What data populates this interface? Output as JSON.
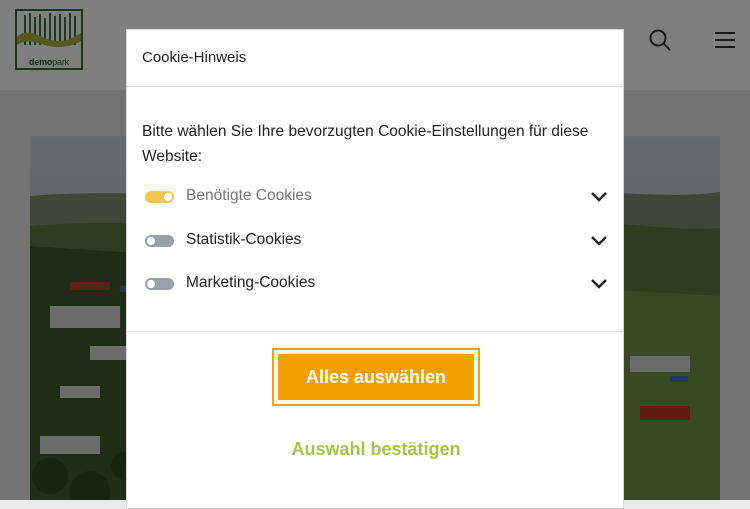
{
  "site": {
    "logo_text_bold": "demo",
    "logo_text_light": "park"
  },
  "modal": {
    "title": "Cookie-Hinweis",
    "intro": "Bitte wählen Sie Ihre bevorzugten Cookie-Einstellungen für diese Website:",
    "options": [
      {
        "label": "Benötigte Cookies",
        "enabled": true,
        "disabled": true
      },
      {
        "label": "Statistik-Cookies",
        "enabled": false,
        "disabled": false
      },
      {
        "label": "Marketing-Cookies",
        "enabled": false,
        "disabled": false
      }
    ],
    "select_all_label": "Alles auswählen",
    "confirm_label": "Auswahl bestätigen"
  },
  "colors": {
    "accent_orange": "#f3a000",
    "accent_green": "#a6c447",
    "toggle_on": "#f0c850",
    "toggle_off": "#9aa0aa",
    "overlay": "rgba(0,0,0,0.5)"
  },
  "icons": {
    "search": "search-icon",
    "menu": "hamburger-menu-icon",
    "chevron": "chevron-down-icon"
  }
}
